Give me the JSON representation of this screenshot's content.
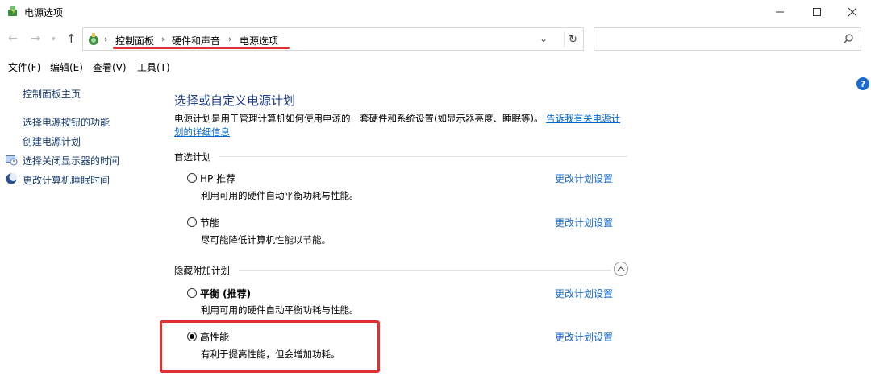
{
  "window": {
    "title": "电源选项"
  },
  "navigation": {
    "breadcrumbs": [
      "控制面板",
      "硬件和声音",
      "电源选项"
    ],
    "search_placeholder": ""
  },
  "menu": [
    "文件(F)",
    "编辑(E)",
    "查看(V)",
    "工具(T)"
  ],
  "sidebar": {
    "items": [
      {
        "label": "控制面板主页",
        "icon": null
      },
      {
        "label": "选择电源按钮的功能",
        "icon": null
      },
      {
        "label": "创建电源计划",
        "icon": null
      },
      {
        "label": "选择关闭显示器的时间",
        "icon": "monitor-clock-icon"
      },
      {
        "label": "更改计算机睡眠时间",
        "icon": "moon-icon"
      }
    ]
  },
  "main": {
    "title": "选择或自定义电源计划",
    "description": "电源计划是用于管理计算机如何使用电源的一套硬件和系统设置(如显示器亮度、睡眠等)。",
    "description_link": "告诉我有关电源计划的详细信息",
    "preferred_group": "首选计划",
    "hidden_group": "隐藏附加计划",
    "change_label": "更改计划设置",
    "plans": [
      {
        "name": "HP 推荐",
        "desc": "利用可用的硬件自动平衡功耗与性能。",
        "checked": false,
        "bold": false
      },
      {
        "name": "节能",
        "desc": "尽可能降低计算机性能以节能。",
        "checked": false,
        "bold": false
      },
      {
        "name": "平衡 (推荐)",
        "desc": "利用可用的硬件自动平衡功耗与性能。",
        "checked": false,
        "bold": true
      },
      {
        "name": "高性能",
        "desc": "有利于提高性能，但会增加功耗。",
        "checked": true,
        "bold": false
      }
    ]
  },
  "colors": {
    "accent_link": "#1a6bd0",
    "heading": "#1e3d8a",
    "highlight": "#e03131"
  }
}
